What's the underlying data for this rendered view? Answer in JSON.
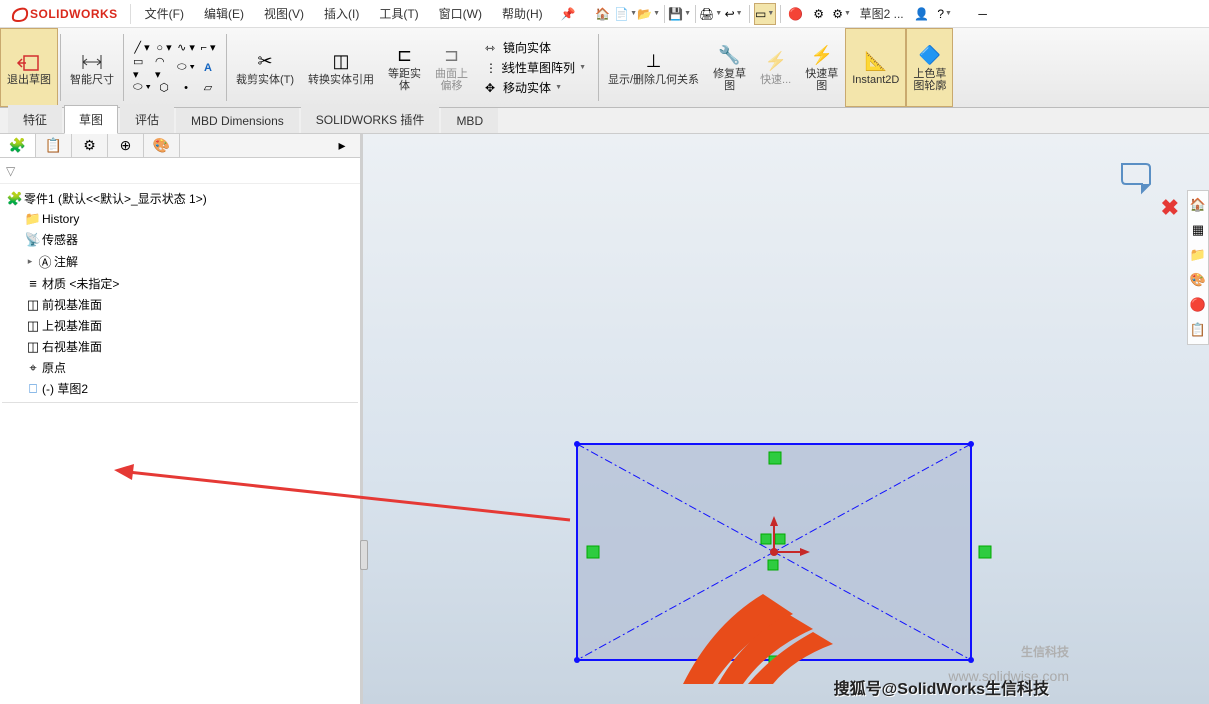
{
  "app": {
    "logo_text": "SOLIDWORKS"
  },
  "menu": {
    "file": "文件(F)",
    "edit": "编辑(E)",
    "view": "视图(V)",
    "insert": "插入(I)",
    "tools": "工具(T)",
    "window": "窗口(W)",
    "help": "帮助(H)"
  },
  "quick": {
    "doc": "草图2 ..."
  },
  "ribbon": {
    "exit_sketch": "退出草图",
    "smart_dim": "智能尺寸",
    "trim": "裁剪实体(T)",
    "convert": "转换实体引用",
    "offset": "等距实\n体",
    "surface_offset": "曲面上\n偏移",
    "mirror": "镜向实体",
    "linear_pattern": "线性草图阵列",
    "move": "移动实体",
    "display_relations": "显示/删除几何关系",
    "repair": "修复草\n图",
    "quick": "快速...",
    "rapid": "快速草\n图",
    "instant": "Instant2D",
    "shade": "上色草\n图轮廓"
  },
  "tabs": {
    "features": "特征",
    "sketch": "草图",
    "evaluate": "评估",
    "mbd_dim": "MBD Dimensions",
    "addins": "SOLIDWORKS 插件",
    "mbd": "MBD"
  },
  "tree": {
    "root": "零件1  (默认<<默认>_显示状态 1>)",
    "history": "History",
    "sensors": "传感器",
    "annotations": "注解",
    "material": "材质 <未指定>",
    "front": "前视基准面",
    "top": "上视基准面",
    "right": "右视基准面",
    "origin": "原点",
    "sketch2": "(-) 草图2"
  },
  "watermark": {
    "brand": "生信科技",
    "url": "www.solidwise.com",
    "attr": "搜狐号@SolidWorks生信科技"
  }
}
